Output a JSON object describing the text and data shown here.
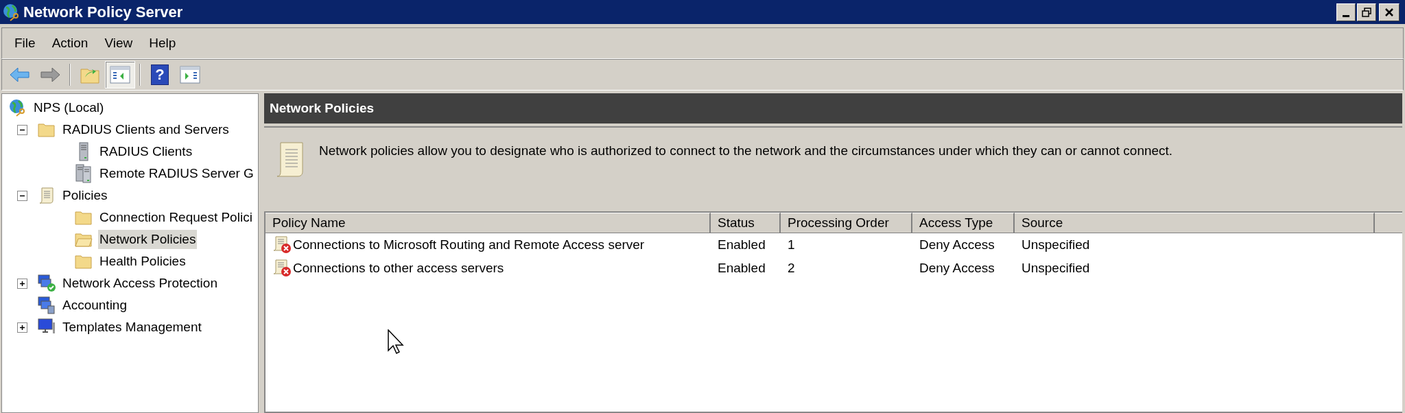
{
  "window": {
    "title": "Network Policy Server"
  },
  "menu": [
    "File",
    "Action",
    "View",
    "Help"
  ],
  "toolbar": [
    {
      "kind": "back",
      "pressed": false
    },
    {
      "kind": "forward",
      "pressed": false
    },
    {
      "kind": "separator"
    },
    {
      "kind": "up",
      "pressed": false
    },
    {
      "kind": "tree-toggle",
      "pressed": true
    },
    {
      "kind": "separator"
    },
    {
      "kind": "help",
      "label": "?",
      "pressed": false
    },
    {
      "kind": "action-pane",
      "pressed": false
    }
  ],
  "tree": [
    {
      "label": "NPS (Local)",
      "kind": "globe",
      "selected": false,
      "children": [
        {
          "label": "RADIUS Clients and Servers",
          "kind": "folder",
          "selected": false,
          "expanded": true,
          "children": [
            {
              "label": "RADIUS Clients",
              "kind": "server",
              "selected": false
            },
            {
              "label": "Remote RADIUS Server G",
              "kind": "servers",
              "selected": false
            }
          ]
        },
        {
          "label": "Policies",
          "kind": "scroll",
          "selected": false,
          "expanded": true,
          "children": [
            {
              "label": "Connection Request Polici",
              "kind": "folder",
              "selected": false
            },
            {
              "label": "Network Policies",
              "kind": "folder-open",
              "selected": true
            },
            {
              "label": "Health Policies",
              "kind": "folder",
              "selected": false
            }
          ]
        },
        {
          "label": "Network Access Protection",
          "kind": "nap",
          "selected": false,
          "expanded": false
        },
        {
          "label": "Accounting",
          "kind": "accounting",
          "selected": false
        },
        {
          "label": "Templates Management",
          "kind": "monitor",
          "selected": false,
          "expanded": false
        }
      ]
    }
  ],
  "panel": {
    "title": "Network Policies",
    "description": "Network policies allow you to designate who is authorized to connect to the network and the circumstances under which they can or cannot connect."
  },
  "table": {
    "columns": [
      "Policy Name",
      "Status",
      "Processing Order",
      "Access Type",
      "Source"
    ],
    "rows": [
      {
        "cells": [
          "Connections to Microsoft Routing and Remote Access server",
          "Enabled",
          "1",
          "Deny Access",
          "Unspecified"
        ],
        "deny": true
      },
      {
        "cells": [
          "Connections to other access servers",
          "Enabled",
          "2",
          "Deny Access",
          "Unspecified"
        ],
        "deny": true
      }
    ]
  }
}
